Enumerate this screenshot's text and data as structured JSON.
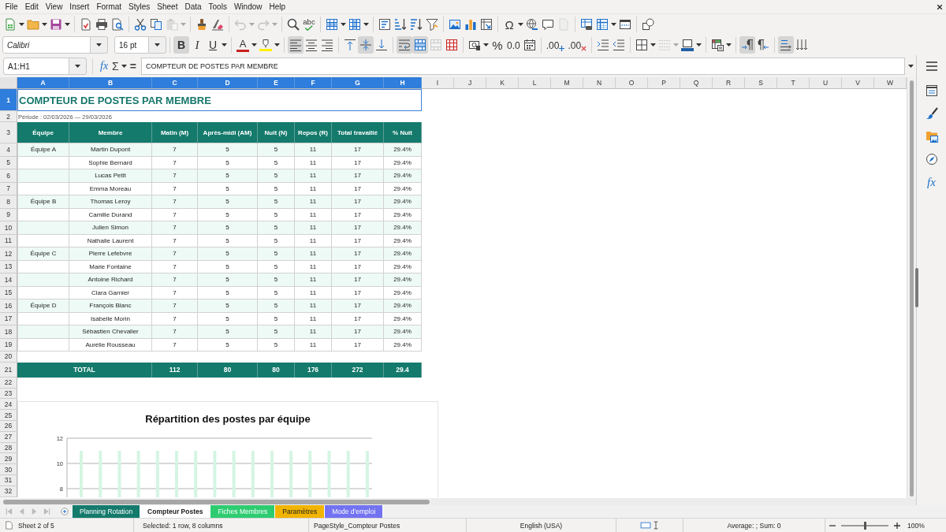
{
  "menu_bar": {
    "items": [
      "File",
      "Edit",
      "View",
      "Insert",
      "Format",
      "Styles",
      "Sheet",
      "Data",
      "Tools",
      "Window",
      "Help"
    ]
  },
  "toolbar_1": {
    "groups": [
      [
        {
          "kind": "new-spreadsheet",
          "disabled": false
        },
        {
          "kind": "dropdown",
          "disabled": false
        },
        {
          "kind": "open",
          "disabled": false
        },
        {
          "kind": "dropdown",
          "disabled": false
        },
        {
          "kind": "save",
          "disabled": false
        },
        {
          "kind": "dropdown",
          "disabled": false
        }
      ],
      [
        {
          "kind": "export-pdf",
          "disabled": false
        },
        {
          "kind": "print",
          "disabled": false
        },
        {
          "kind": "print-preview",
          "disabled": false
        }
      ],
      [
        {
          "kind": "cut",
          "disabled": false
        },
        {
          "kind": "copy",
          "disabled": false
        },
        {
          "kind": "paste",
          "disabled": true
        },
        {
          "kind": "dropdown",
          "disabled": true
        }
      ],
      [
        {
          "kind": "clone-formatting",
          "disabled": false
        },
        {
          "kind": "clear-formatting",
          "disabled": false
        }
      ],
      [
        {
          "kind": "undo",
          "disabled": true
        },
        {
          "kind": "dropdown",
          "disabled": true
        },
        {
          "kind": "redo",
          "disabled": true
        },
        {
          "kind": "dropdown",
          "disabled": true
        }
      ],
      [
        {
          "kind": "find-replace",
          "disabled": false
        },
        {
          "kind": "spelling",
          "label": "abc",
          "disabled": false
        }
      ],
      [
        {
          "kind": "rows",
          "disabled": false
        },
        {
          "kind": "dropdown",
          "disabled": false
        },
        {
          "kind": "columns",
          "disabled": false
        },
        {
          "kind": "dropdown",
          "disabled": false
        }
      ],
      [
        {
          "kind": "sort",
          "disabled": false
        },
        {
          "kind": "sort-ascending",
          "disabled": false
        },
        {
          "kind": "sort-descending",
          "disabled": false
        },
        {
          "kind": "autofilter",
          "disabled": false
        }
      ],
      [
        {
          "kind": "image",
          "disabled": false
        },
        {
          "kind": "chart",
          "disabled": false
        },
        {
          "kind": "pivot-table",
          "disabled": false
        }
      ],
      [
        {
          "kind": "special-character",
          "label": "Ω",
          "disabled": false
        },
        {
          "kind": "dropdown",
          "disabled": false
        },
        {
          "kind": "hyperlink",
          "disabled": false
        },
        {
          "kind": "comment",
          "disabled": false
        },
        {
          "kind": "header-footer",
          "disabled": true
        }
      ],
      [
        {
          "kind": "print-range",
          "disabled": false
        },
        {
          "kind": "freeze",
          "disabled": false
        },
        {
          "kind": "dropdown",
          "disabled": false
        },
        {
          "kind": "split-window",
          "disabled": false
        }
      ],
      [
        {
          "kind": "draw-functions",
          "disabled": false
        }
      ]
    ]
  },
  "toolbar_2": {
    "font_name": "Calibri",
    "font_size": "16 pt",
    "groups": [
      [
        {
          "kind": "bold",
          "label": "B",
          "on": true,
          "disabled": false
        },
        {
          "kind": "italic",
          "label": "I",
          "on": false,
          "disabled": false
        },
        {
          "kind": "underline",
          "label": "U",
          "on": false,
          "disabled": false
        },
        {
          "kind": "dropdown",
          "on": false,
          "disabled": false
        }
      ],
      [
        {
          "kind": "font-color",
          "label": "A",
          "on": false,
          "disabled": false
        },
        {
          "kind": "dropdown",
          "on": false,
          "disabled": false
        },
        {
          "kind": "highlight",
          "on": false,
          "disabled": false
        },
        {
          "kind": "dropdown",
          "on": false,
          "disabled": false
        }
      ],
      [
        {
          "kind": "align-left",
          "on": true,
          "disabled": false
        },
        {
          "kind": "align-center",
          "on": false,
          "disabled": false
        },
        {
          "kind": "align-right",
          "on": false,
          "disabled": false
        }
      ],
      [
        {
          "kind": "align-top",
          "on": false,
          "disabled": false
        },
        {
          "kind": "align-middle",
          "on": true,
          "disabled": false
        },
        {
          "kind": "align-bottom",
          "on": false,
          "disabled": false
        }
      ],
      [
        {
          "kind": "wrap-text",
          "on": true,
          "disabled": false
        },
        {
          "kind": "merge-center",
          "on": true,
          "disabled": false
        },
        {
          "kind": "merge",
          "on": false,
          "disabled": true
        },
        {
          "kind": "unmerge",
          "on": false,
          "disabled": false
        }
      ],
      [
        {
          "kind": "currency",
          "on": false,
          "disabled": false
        },
        {
          "kind": "dropdown",
          "on": false,
          "disabled": false
        },
        {
          "kind": "percent",
          "label": "%",
          "on": false,
          "disabled": false
        },
        {
          "kind": "number",
          "label": "0.0",
          "on": false,
          "disabled": false
        },
        {
          "kind": "date",
          "on": false,
          "disabled": false
        }
      ],
      [
        {
          "kind": "add-decimal",
          "label": ".00",
          "on": false,
          "disabled": false
        },
        {
          "kind": "delete-decimal",
          "label": ".00",
          "on": false,
          "disabled": false
        }
      ],
      [
        {
          "kind": "indent-increase",
          "on": false,
          "disabled": false
        },
        {
          "kind": "indent-decrease",
          "on": false,
          "disabled": false
        }
      ],
      [
        {
          "kind": "borders",
          "on": false,
          "disabled": false
        },
        {
          "kind": "dropdown",
          "on": false,
          "disabled": false
        },
        {
          "kind": "border-style",
          "on": false,
          "disabled": true
        },
        {
          "kind": "dropdown",
          "on": false,
          "disabled": true
        },
        {
          "kind": "border-color",
          "on": false,
          "disabled": false
        },
        {
          "kind": "dropdown",
          "on": false,
          "disabled": false
        }
      ],
      [
        {
          "kind": "conditional",
          "on": false,
          "disabled": false
        },
        {
          "kind": "dropdown",
          "on": false,
          "disabled": false
        }
      ],
      [
        {
          "kind": "paragraph-ltr",
          "on": true,
          "disabled": false
        },
        {
          "kind": "paragraph-rtl",
          "on": false,
          "disabled": false
        }
      ],
      [
        {
          "kind": "text-ltr",
          "on": true,
          "disabled": false
        },
        {
          "kind": "text-ttb",
          "on": false,
          "disabled": false
        }
      ]
    ]
  },
  "formula_bar": {
    "name_box": "A1:H1",
    "function_wizard": "fx",
    "sum": "Σ",
    "equals": "=",
    "content": "COMPTEUR DE POSTES PAR MEMBRE"
  },
  "sidebar": {
    "items": [
      {
        "kind": "menu"
      },
      {
        "kind": "properties"
      },
      {
        "kind": "styles"
      },
      {
        "kind": "gallery"
      },
      {
        "kind": "navigator"
      },
      {
        "kind": "functions",
        "label": "fx"
      }
    ]
  },
  "sheet": {
    "columns": [
      {
        "label": "A",
        "selected": true
      },
      {
        "label": "B",
        "selected": true
      },
      {
        "label": "C",
        "selected": true
      },
      {
        "label": "D",
        "selected": true
      },
      {
        "label": "E",
        "selected": true
      },
      {
        "label": "F",
        "selected": true
      },
      {
        "label": "G",
        "selected": true
      },
      {
        "label": "H",
        "selected": true
      },
      {
        "label": "I",
        "selected": false
      },
      {
        "label": "J",
        "selected": false
      },
      {
        "label": "K",
        "selected": false
      },
      {
        "label": "L",
        "selected": false
      },
      {
        "label": "M",
        "selected": false
      },
      {
        "label": "N",
        "selected": false
      },
      {
        "label": "O",
        "selected": false
      },
      {
        "label": "P",
        "selected": false
      },
      {
        "label": "Q",
        "selected": false
      },
      {
        "label": "R",
        "selected": false
      },
      {
        "label": "S",
        "selected": false
      },
      {
        "label": "T",
        "selected": false
      },
      {
        "label": "U",
        "selected": false
      },
      {
        "label": "V",
        "selected": false
      },
      {
        "label": "W",
        "selected": false
      }
    ],
    "rows": [
      {
        "number": "1",
        "selected": true,
        "kind": "title",
        "text": "COMPTEUR DE POSTES PAR MEMBRE"
      },
      {
        "number": "2",
        "selected": false,
        "kind": "note",
        "text": "Période : 02/03/2026 — 29/03/2026"
      },
      {
        "number": "3",
        "selected": false,
        "kind": "header",
        "cells": [
          "Équipe",
          "Membre",
          "Matin (M)",
          "Après-midi (AM)",
          "Nuit (N)",
          "Repos (R)",
          "Total travaillé",
          "% Nuit"
        ]
      },
      {
        "number": "4",
        "selected": false,
        "kind": "data",
        "team": "Équipe A",
        "member": "Martin Dupont",
        "values": [
          "7",
          "5",
          "5",
          "11",
          "17",
          "29.4%"
        ]
      },
      {
        "number": "5",
        "selected": false,
        "kind": "data",
        "member": "Sophie Bernard",
        "values": [
          "7",
          "5",
          "5",
          "11",
          "17",
          "29.4%"
        ]
      },
      {
        "number": "6",
        "selected": false,
        "kind": "data",
        "member": "Lucas Petit",
        "values": [
          "7",
          "5",
          "5",
          "11",
          "17",
          "29.4%"
        ]
      },
      {
        "number": "7",
        "selected": false,
        "kind": "data",
        "member": "Emma Moreau",
        "values": [
          "7",
          "5",
          "5",
          "11",
          "17",
          "29.4%"
        ]
      },
      {
        "number": "8",
        "selected": false,
        "kind": "data",
        "team": "Équipe B",
        "member": "Thomas Leroy",
        "values": [
          "7",
          "5",
          "5",
          "11",
          "17",
          "29.4%"
        ]
      },
      {
        "number": "9",
        "selected": false,
        "kind": "data",
        "member": "Camille Durand",
        "values": [
          "7",
          "5",
          "5",
          "11",
          "17",
          "29.4%"
        ]
      },
      {
        "number": "10",
        "selected": false,
        "kind": "data",
        "member": "Julien Simon",
        "values": [
          "7",
          "5",
          "5",
          "11",
          "17",
          "29.4%"
        ]
      },
      {
        "number": "11",
        "selected": false,
        "kind": "data",
        "member": "Nathalie Laurent",
        "values": [
          "7",
          "5",
          "5",
          "11",
          "17",
          "29.4%"
        ]
      },
      {
        "number": "12",
        "selected": false,
        "kind": "data",
        "team": "Équipe C",
        "member": "Pierre Lefebvre",
        "values": [
          "7",
          "5",
          "5",
          "11",
          "17",
          "29.4%"
        ]
      },
      {
        "number": "13",
        "selected": false,
        "kind": "data",
        "member": "Marie Fontaine",
        "values": [
          "7",
          "5",
          "5",
          "11",
          "17",
          "29.4%"
        ]
      },
      {
        "number": "14",
        "selected": false,
        "kind": "data",
        "member": "Antoine Richard",
        "values": [
          "7",
          "5",
          "5",
          "11",
          "17",
          "29.4%"
        ]
      },
      {
        "number": "15",
        "selected": false,
        "kind": "data",
        "member": "Clara Garnier",
        "values": [
          "7",
          "5",
          "5",
          "11",
          "17",
          "29.4%"
        ]
      },
      {
        "number": "16",
        "selected": false,
        "kind": "data",
        "team": "Équipe D",
        "member": "François Blanc",
        "values": [
          "7",
          "5",
          "5",
          "11",
          "17",
          "29.4%"
        ]
      },
      {
        "number": "17",
        "selected": false,
        "kind": "data",
        "member": "Isabelle Morin",
        "values": [
          "7",
          "5",
          "5",
          "11",
          "17",
          "29.4%"
        ]
      },
      {
        "number": "18",
        "selected": false,
        "kind": "data",
        "member": "Sébastien Chevalier",
        "values": [
          "7",
          "5",
          "5",
          "11",
          "17",
          "29.4%"
        ]
      },
      {
        "number": "19",
        "selected": false,
        "kind": "data",
        "member": "Aurélie Rousseau",
        "values": [
          "7",
          "5",
          "5",
          "11",
          "17",
          "29.4%"
        ]
      },
      {
        "number": "20",
        "selected": false,
        "kind": "empty"
      },
      {
        "number": "21",
        "selected": false,
        "kind": "total",
        "label": "TOTAL",
        "values": [
          "112",
          "80",
          "80",
          "176",
          "272",
          "29.4"
        ]
      },
      {
        "number": "22",
        "selected": false,
        "kind": "empty"
      },
      {
        "number": "23",
        "selected": false,
        "kind": "empty"
      },
      {
        "number": "24",
        "selected": false,
        "kind": "empty"
      },
      {
        "number": "25",
        "selected": false,
        "kind": "empty"
      },
      {
        "number": "26",
        "selected": false,
        "kind": "empty"
      },
      {
        "number": "27",
        "selected": false,
        "kind": "empty"
      },
      {
        "number": "28",
        "selected": false,
        "kind": "empty"
      },
      {
        "number": "29",
        "selected": false,
        "kind": "empty"
      },
      {
        "number": "30",
        "selected": false,
        "kind": "empty"
      },
      {
        "number": "31",
        "selected": false,
        "kind": "empty"
      },
      {
        "number": "32",
        "selected": false,
        "kind": "empty"
      }
    ],
    "chart": {
      "chart_data": {
        "type": "bar",
        "title": "Répartition des postes par équipe",
        "ylim": [
          8,
          12
        ],
        "yticks": [
          8,
          10,
          12
        ],
        "series": [
          {
            "color": "#d5f5e3",
            "values": [
              11,
              11,
              11,
              11,
              11,
              11,
              11,
              11,
              11,
              11,
              11,
              11,
              11,
              11,
              11,
              11
            ]
          }
        ]
      }
    }
  },
  "sheet_tabs": {
    "navigation": [
      {
        "kind": "first",
        "disabled": true
      },
      {
        "kind": "previous",
        "disabled": true
      },
      {
        "kind": "next",
        "disabled": true
      },
      {
        "kind": "last",
        "disabled": true
      }
    ],
    "tabs": [
      {
        "label": "Planning Rotation",
        "selected": false,
        "color": "#147a6c"
      },
      {
        "label": "Compteur Postes",
        "selected": true
      },
      {
        "label": "Fiches Membres",
        "selected": false,
        "color": "#2ecc71"
      },
      {
        "label": "Paramètres",
        "selected": false,
        "color": "#f1b400"
      },
      {
        "label": "Mode d'emploi",
        "selected": false,
        "color": "#7272f2"
      }
    ]
  },
  "status_bar": {
    "sheet": "Sheet 2 of 5",
    "selection": "Selected: 1 row, 8 columns",
    "page_style": "PageStyle_Compteur Postes",
    "language": "English (USA)",
    "summary": "Average: ; Sum: 0",
    "zoom": {
      "level": 0.5,
      "label": "100%"
    }
  }
}
